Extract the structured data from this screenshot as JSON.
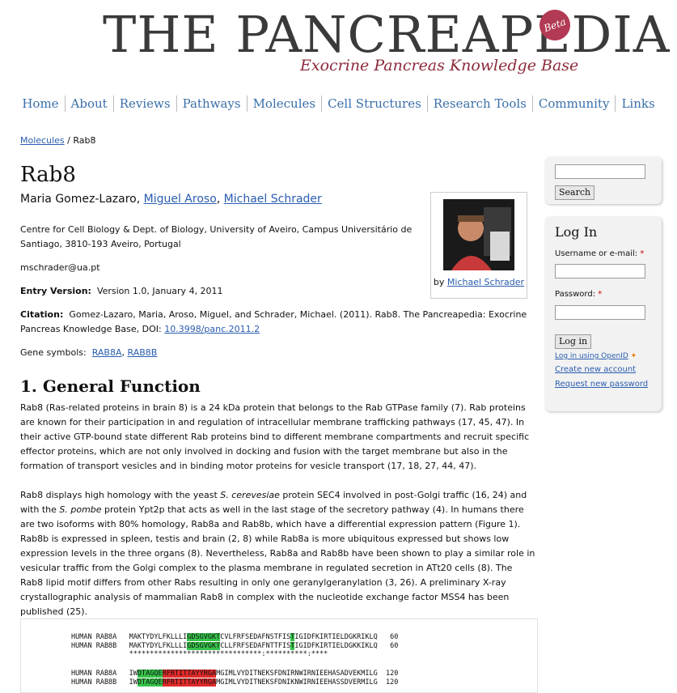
{
  "header": {
    "title": "THE PANCREAPEDIA",
    "subtitle": "Exocrine Pancreas Knowledge Base",
    "beta": "Beta"
  },
  "nav": [
    "Home",
    "About",
    "Reviews",
    "Pathways",
    "Molecules",
    "Cell Structures",
    "Research Tools",
    "Community",
    "Links"
  ],
  "breadcrumb": {
    "link": "Molecules",
    "sep": " / ",
    "current": "Rab8"
  },
  "page": {
    "title": "Rab8",
    "authors": [
      {
        "name": "Maria Gomez-Lazaro",
        "link": false
      },
      {
        "name": "Miguel Aroso",
        "link": true
      },
      {
        "name": "Michael Schrader",
        "link": true
      }
    ],
    "affiliation": "Centre for Cell Biology & Dept. of Biology, University of Aveiro, Campus Universitário de Santiago, 3810-193 Aveiro, Portugal",
    "email": "mschrader@ua.pt",
    "entry_version_label": "Entry Version:",
    "entry_version": "Version 1.0, January 4, 2011",
    "citation_label": "Citation:",
    "citation_text": "Gomez-Lazaro, Maria, Aroso, Miguel, and Schrader, Michael. (2011). Rab8. The Pancreapedia: Exocrine Pancreas Knowledge Base, DOI: ",
    "citation_doi": "10.3998/panc.2011.2",
    "gene_label": "Gene symbols:",
    "genes": [
      "RAB8A",
      "RAB8B"
    ],
    "photo_by": "by ",
    "photo_author": "Michael Schrader"
  },
  "section1": {
    "title": "1. General Function",
    "p1": "Rab8 (Ras-related proteins in brain 8) is a 24 kDa protein that belongs to the Rab GTPase family (7). Rab proteins are known for their participation in and regulation of intracellular membrane trafficking pathways (17, 45, 47). In their active GTP-bound state different Rab proteins bind to different membrane compartments and recruit specific effector proteins, which are not only involved in docking and fusion with the target membrane but also in the formation of transport vesicles and in binding motor proteins for vesicle transport (17, 18, 27, 44, 47).",
    "p2a": "Rab8 displays high homology with the yeast ",
    "p2b": "S. cerevesiae",
    "p2c": " protein SEC4 involved in post-Golgi traffic (16, 24) and with the ",
    "p2d": "S. pombe",
    "p2e": " protein Ypt2p that acts as well in the last stage of the secretory pathway (4). In humans there are two isoforms with 80% homology, Rab8a and Rab8b, which have a differential expression pattern (Figure 1). Rab8b is expressed in spleen, testis and brain (2, 8) while Rab8a is more ubiquitous expressed but shows low expression levels in the three organs (8). Nevertheless, Rab8a and Rab8b have been shown to play a similar role in vesicular traffic from the Golgi complex to the plasma membrane in regulated secretion in ATt20 cells (8). The Rab8 lipid motif differs from other Rabs resulting in only one geranylgeranylation (3, 26). A preliminary X-ray crystallographic analysis of mammalian Rab8 in complex with the nucleotide exchange factor MSS4 has been published (25)."
  },
  "sidebar": {
    "search_button": "Search",
    "login_title": "Log In",
    "username_label": "Username or e-mail: ",
    "password_label": "Password: ",
    "required_mark": "*",
    "login_button": "Log in",
    "openid_link": "Log in using OpenID",
    "create_account": "Create new account",
    "request_password": "Request new password"
  },
  "alignment": {
    "rows": [
      {
        "pre": "HUMAN RAB8A   MAKTYDYLFKLLLI",
        "g1": "GDSGVGKT",
        "mid": "CVLFRFSEDAFNSTFIS",
        "g2": "T",
        "post": "IGIDFKIRTIELDGKRIKLQ   60"
      },
      {
        "pre": "HUMAN RAB8B   MAKTYDYLFKLLLI",
        "g1": "GDSGVGKT",
        "mid": "CLLFRFSEDAFNTTFIS",
        "g2": "T",
        "post": "IGIDFKIRTIELDGKKIKLQ   60"
      },
      {
        "pre": "              ********************************:**********:****",
        "g1": "",
        "mid": "",
        "g2": "",
        "post": ""
      },
      {
        "pre": "HUMAN RAB8A   IW",
        "g1": "DTAGQE",
        "mid": "",
        "g2": "RFRTITTAYYRGA",
        "post": "MGIMLVYDITNEKSFDNIRNWIRNIEEHASADVEKMILG  120"
      },
      {
        "pre": "HUMAN RAB8B   IW",
        "g1": "DTAGQE",
        "mid": "",
        "g2": "RFRTITTAYYRGA",
        "post": "MGIMLVYDITNEKSFDNIKNWIRNIEEHASSDVERMILG  120"
      }
    ]
  }
}
